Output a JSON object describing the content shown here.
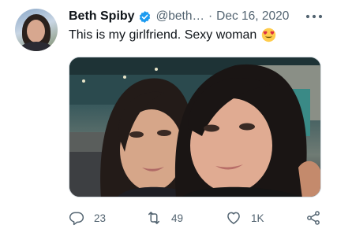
{
  "tweet": {
    "author_name": "Beth Spiby",
    "handle": "@beth…",
    "separator": "·",
    "date": "Dec 16, 2020",
    "text": "This is my girlfriend. Sexy woman",
    "verified": true,
    "emoji": "heart-eyes-emoji"
  },
  "counts": {
    "replies": "23",
    "retweets": "49",
    "likes": "1K"
  },
  "colors": {
    "verified_blue": "#1d9bf0",
    "secondary_text": "#536471",
    "primary_text": "#0f1419"
  }
}
